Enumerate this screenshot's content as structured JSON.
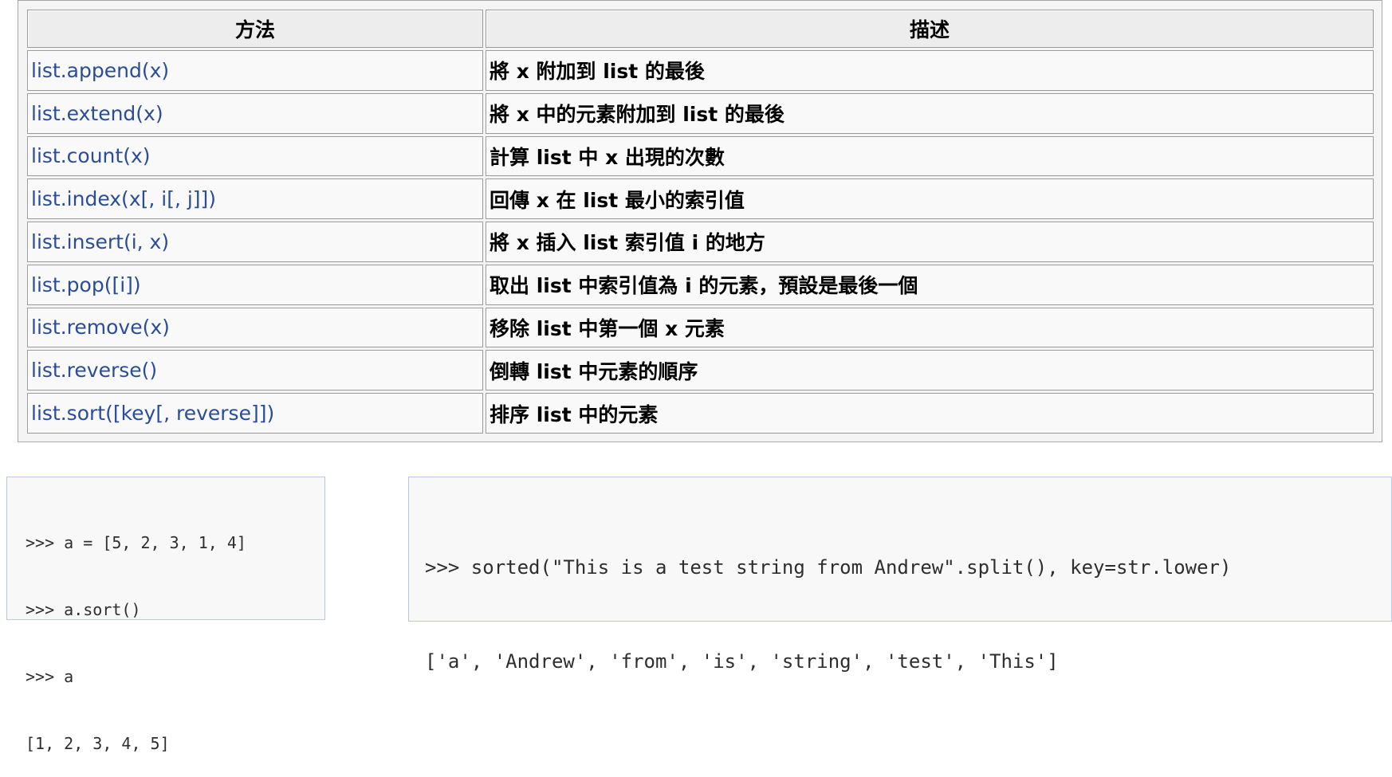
{
  "table": {
    "headers": {
      "method": "方法",
      "description": "描述"
    },
    "rows": [
      {
        "method": "list.append(x)",
        "description": "將 x 附加到 list 的最後"
      },
      {
        "method": "list.extend(x)",
        "description": "將 x 中的元素附加到 list 的最後"
      },
      {
        "method": "list.count(x)",
        "description": "計算 list 中 x 出現的次數"
      },
      {
        "method": "list.index(x[, i[, j]])",
        "description": "回傳 x 在 list 最小的索引值"
      },
      {
        "method": "list.insert(i, x)",
        "description": "將 x 插入 list 索引值 i 的地方"
      },
      {
        "method": "list.pop([i])",
        "description": "取出 list 中索引值為 i 的元素，預設是最後一個"
      },
      {
        "method": "list.remove(x)",
        "description": "移除 list 中第一個 x 元素"
      },
      {
        "method": "list.reverse()",
        "description": "倒轉 list 中元素的順序"
      },
      {
        "method": "list.sort([key[, reverse]])",
        "description": "排序 list 中的元素"
      }
    ]
  },
  "code_left": {
    "lines": [
      ">>> a = [5, 2, 3, 1, 4]",
      ">>> a.sort()",
      ">>> a",
      "[1, 2, 3, 4, 5]"
    ]
  },
  "code_right": {
    "lines": [
      ">>> sorted(\"This is a test string from Andrew\".split(), key=str.lower)",
      "['a', 'Andrew', 'from', 'is', 'string', 'test', 'This']"
    ]
  }
}
